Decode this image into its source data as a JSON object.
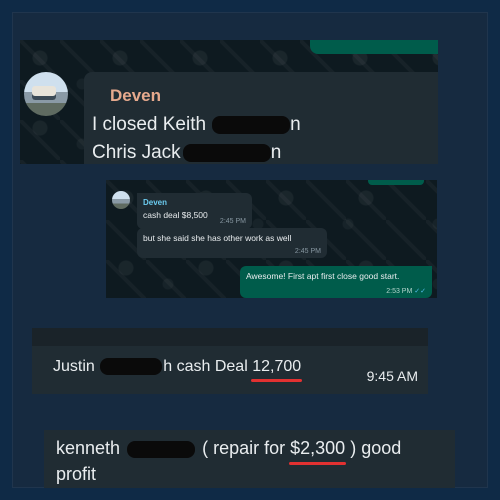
{
  "screenshot1": {
    "sender": "Deven",
    "line1": "I closed Keith",
    "line1_tail": "n",
    "line2": "Chris Jack",
    "line2_tail": "n"
  },
  "screenshot2": {
    "sender": "Deven",
    "msg1": "cash deal $8,500",
    "msg1_time": "2:45 PM",
    "msg2": "but she said she has other work as well",
    "msg2_time": "2:45 PM",
    "msg3": "Awesome! First apt first close good start.",
    "msg3_time": "2:53 PM",
    "msg3_ticks": "✓✓"
  },
  "screenshot3": {
    "prefix": "Justin",
    "suffix": "h cash Deal",
    "amount": "12,700",
    "time": "9:45 AM"
  },
  "screenshot4": {
    "prefix": "kenneth",
    "middle": "( repair for",
    "amount": "$2,300",
    "suffix": ") good",
    "line2": "profit"
  },
  "colors": {
    "page_bg": "#0f2a46",
    "chat_bg": "#0e1a20",
    "incoming_bubble": "#202c33",
    "outgoing_bubble": "#005c4b",
    "sender_name_1": "#e6a98d",
    "sender_name_2": "#6bcbef",
    "underline": "#e23131"
  }
}
